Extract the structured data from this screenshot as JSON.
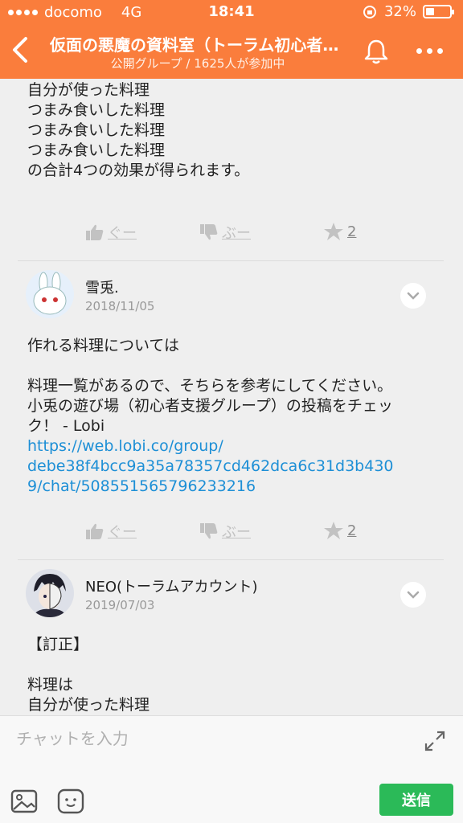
{
  "status_bar": {
    "carrier": "docomo",
    "network": "4G",
    "time": "18:41",
    "battery": "32%"
  },
  "header": {
    "title": "仮面の悪魔の資料室（トーラム初心者…",
    "subtitle": "公開グループ / 1625人が参加中",
    "accent_color": "#fa7d3c"
  },
  "messages": [
    {
      "lines": [
        "自分が使った料理",
        "つまみ食いした料理",
        "つまみ食いした料理",
        "つまみ食いした料理",
        "の合計4つの効果が得られます。"
      ],
      "actions": {
        "good": "ぐー",
        "boo": "ぶー",
        "star": "2"
      }
    },
    {
      "author": "雪兎.",
      "date": "2018/11/05",
      "lines": [
        "作れる料理については",
        "",
        "料理一覧があるので、そちらを参考にしてください。",
        "小兎の遊び場（初心者支援グループ）の投稿をチェッ",
        "ク！ - Lobi"
      ],
      "link_lines": [
        "https://web.lobi.co/group/",
        "debe38f4bcc9a35a78357cd462dca6c31d3b430",
        "9/chat/508551565796233216"
      ],
      "actions": {
        "good": "ぐー",
        "boo": "ぶー",
        "star": "2"
      }
    },
    {
      "author": "NEO(トーラムアカウント)",
      "date": "2019/07/03",
      "lines": [
        "【訂正】",
        "",
        "料理は",
        "自分が使った料理"
      ]
    }
  ],
  "input": {
    "placeholder": "チャットを入力",
    "send_label": "送信"
  },
  "icons": [
    "back-icon",
    "bell-icon",
    "more-icon",
    "thumbs-up-icon",
    "thumbs-down-icon",
    "star-icon",
    "chevron-down-icon",
    "expand-icon",
    "image-icon",
    "stamp-icon"
  ]
}
